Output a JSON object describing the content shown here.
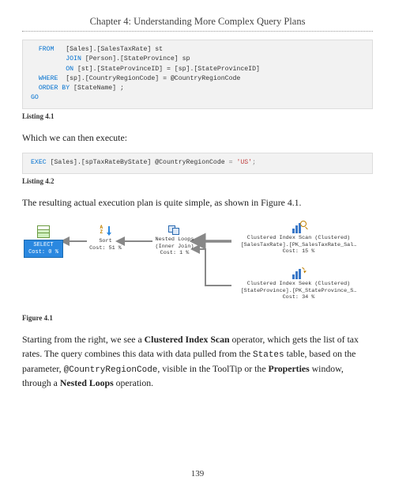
{
  "chapter_title": "Chapter 4: Understanding More Complex Query Plans",
  "code1": {
    "l1_kw": "FROM",
    "l1_rest": "   [Sales].[SalesTaxRate] st",
    "l2_kw": "JOIN",
    "l2_rest": " [Person].[StateProvince] sp",
    "l3_kw": "ON",
    "l3_rest": " [st].[StateProvinceID] = [sp].[StateProvinceID]",
    "l4_kw": "WHERE",
    "l4_rest": "  [sp].[CountryRegionCode] = @CountryRegionCode",
    "l5_kw": "ORDER BY",
    "l5_rest": " [StateName] ;",
    "l6": "GO"
  },
  "listing1_label": "Listing 4.1",
  "para1": "Which we can then execute:",
  "code2": {
    "kw": "EXEC",
    "obj": " [Sales].[spTaxRateByState] ",
    "var": "@CountryRegionCode",
    "eq": " = ",
    "str": "'US'",
    "semi": ";"
  },
  "listing2_label": "Listing 4.2",
  "para2": "The resulting actual execution plan is quite simple, as shown in Figure 4.1.",
  "plan": {
    "select": {
      "l1": "SELECT",
      "l2": "Cost: 0 %"
    },
    "sort": {
      "l1": "Sort",
      "l2": "Cost: 51 %"
    },
    "loops": {
      "l1": "Nested Loops",
      "l2": "(Inner Join)",
      "l3": "Cost: 1 %"
    },
    "scan": {
      "l1": "Clustered Index Scan (Clustered)",
      "l2": "[SalesTaxRate].[PK_SalesTaxRate_Sal…",
      "l3": "Cost: 15 %"
    },
    "seek": {
      "l1": "Clustered Index Seek (Clustered)",
      "l2": "[StateProvince].[PK_StateProvince_S…",
      "l3": "Cost: 34 %"
    }
  },
  "figure_label": "Figure 4.1",
  "para3": {
    "t1": "Starting from the right, we see a ",
    "b1": "Clustered Index Scan",
    "t2": " operator, which gets the list of tax rates. The query combines this data with data pulled from the ",
    "m1": "States",
    "t3": " table, based on the parameter, ",
    "m2": "@CountryRegionCode",
    "t4": ", visible in the ToolTip or the ",
    "b2": "Properties",
    "t5": " window, through a ",
    "b3": "Nested Loops",
    "t6": " operation."
  },
  "page_number": "139"
}
